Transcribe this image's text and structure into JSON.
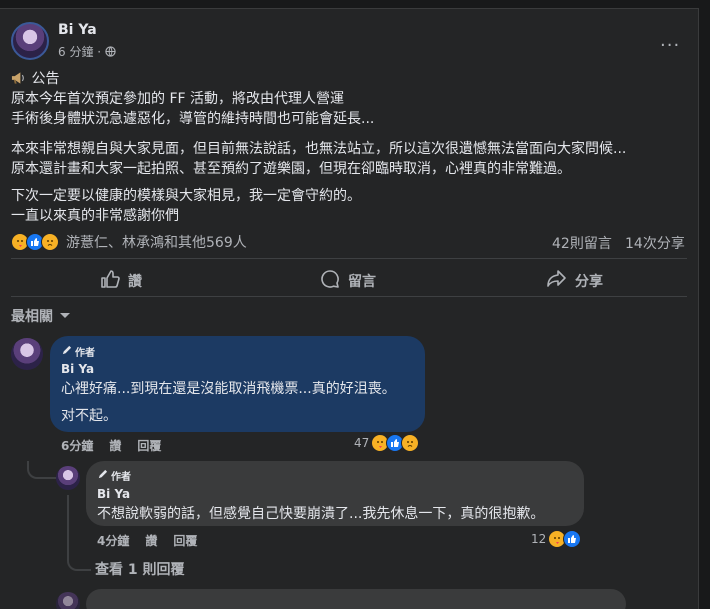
{
  "post": {
    "author": "Bi Ya",
    "time": "6 分鐘",
    "visibility_sep": "·",
    "more": "···",
    "lines": [
      "公告",
      "原本今年首次預定參加的 FF 活動，將改由代理人營運",
      "手術後身體狀況急遽惡化，導管的維持時間也可能會延長...",
      "本來非常想親自與大家見面，但目前無法說話，也無法站立，所以這次很遺憾無法當面向大家問候...",
      "原本還計畫和大家一起拍照、甚至預約了遊樂園，但現在卻臨時取消，心裡真的非常難過。",
      "下次一定要以健康的模樣與大家相見，我一定會守約的。",
      "一直以來真的非常感謝你們"
    ],
    "reactions_text": "游薏仁、林承鴻和其他569人",
    "comments_count": "42則留言",
    "shares_count": "14次分享",
    "icons": [
      "megaphone-icon",
      "globe-icon",
      "care-reaction-icon",
      "like-reaction-icon",
      "sad-reaction-icon"
    ]
  },
  "actions": {
    "like": "讚",
    "comment": "留言",
    "share": "分享"
  },
  "sort": {
    "label": "最相關"
  },
  "comments": [
    {
      "badge": "作者",
      "author": "Bi Ya",
      "text1": "心裡好痛...到現在還是沒能取消飛機票...真的好沮喪。",
      "text2": "对不起。",
      "time": "6分鐘",
      "like": "讚",
      "reply": "回覆",
      "reaction_count": "47"
    },
    {
      "badge": "作者",
      "author": "Bi Ya",
      "text1": "不想說軟弱的話，但感覺自己快要崩潰了...我先休息一下，真的很抱歉。",
      "time": "4分鐘",
      "like": "讚",
      "reply": "回覆",
      "reaction_count": "12"
    }
  ],
  "view_replies": "查看 1 則回覆",
  "colors": {
    "background": "#18191a",
    "card": "#242526",
    "author_bubble": "#1c3a63",
    "reply_bubble": "#3a3b3c",
    "text": "#e4e6eb",
    "muted": "#b0b3b8",
    "like_blue": "#1877f2",
    "emoji_yellow": "#f7b125"
  }
}
